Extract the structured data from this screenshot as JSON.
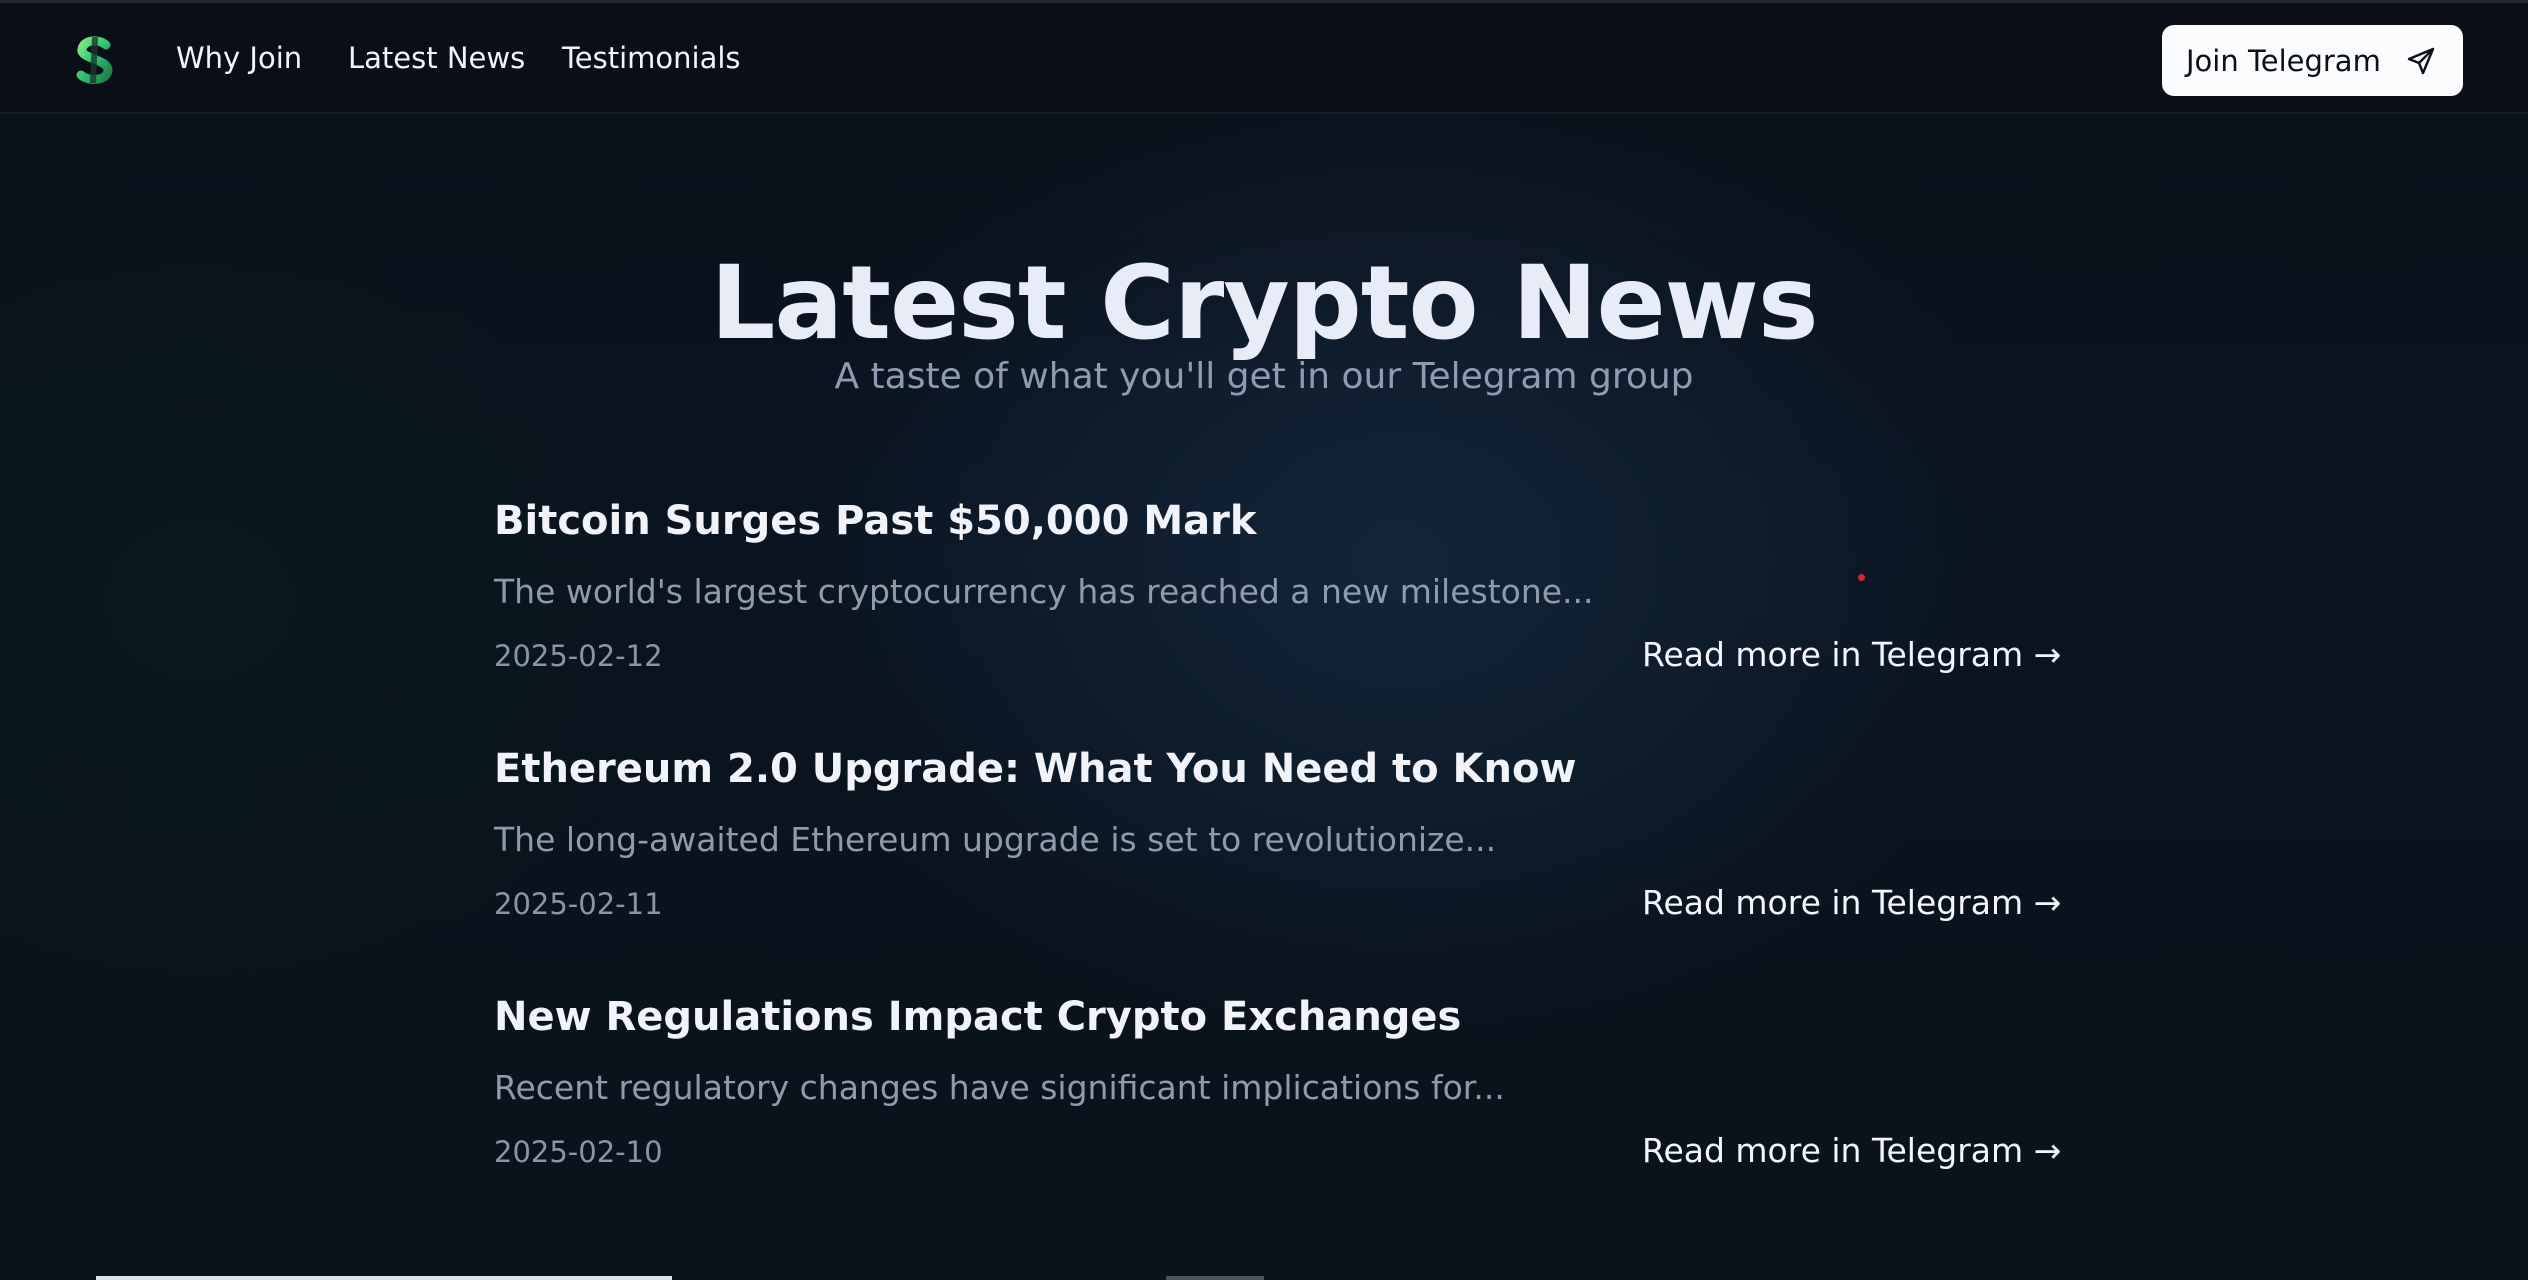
{
  "nav": {
    "logo_icon": "dollar-s-logo-icon",
    "links": [
      "Why Join",
      "Latest News",
      "Testimonials"
    ],
    "cta_label": "Join Telegram",
    "cta_icon": "send-icon"
  },
  "hero": {
    "title": "Latest Crypto News",
    "subtitle": "A taste of what you'll get in our Telegram group"
  },
  "articles": [
    {
      "title": "Bitcoin Surges Past $50,000 Mark",
      "excerpt": "The world's largest cryptocurrency has reached a new milestone...",
      "date": "2025-02-12",
      "link_label": "Read more in Telegram →"
    },
    {
      "title": "Ethereum 2.0 Upgrade: What You Need to Know",
      "excerpt": "The long-awaited Ethereum upgrade is set to revolutionize...",
      "date": "2025-02-11",
      "link_label": "Read more in Telegram →"
    },
    {
      "title": "New Regulations Impact Crypto Exchanges",
      "excerpt": "Recent regulatory changes have significant implications for...",
      "date": "2025-02-10",
      "link_label": "Read more in Telegram →"
    }
  ],
  "colors": {
    "background": "#0a0f18",
    "accent_green": "#4ade80",
    "button_bg": "#fbfcfd",
    "muted_text": "#8f9aab"
  }
}
